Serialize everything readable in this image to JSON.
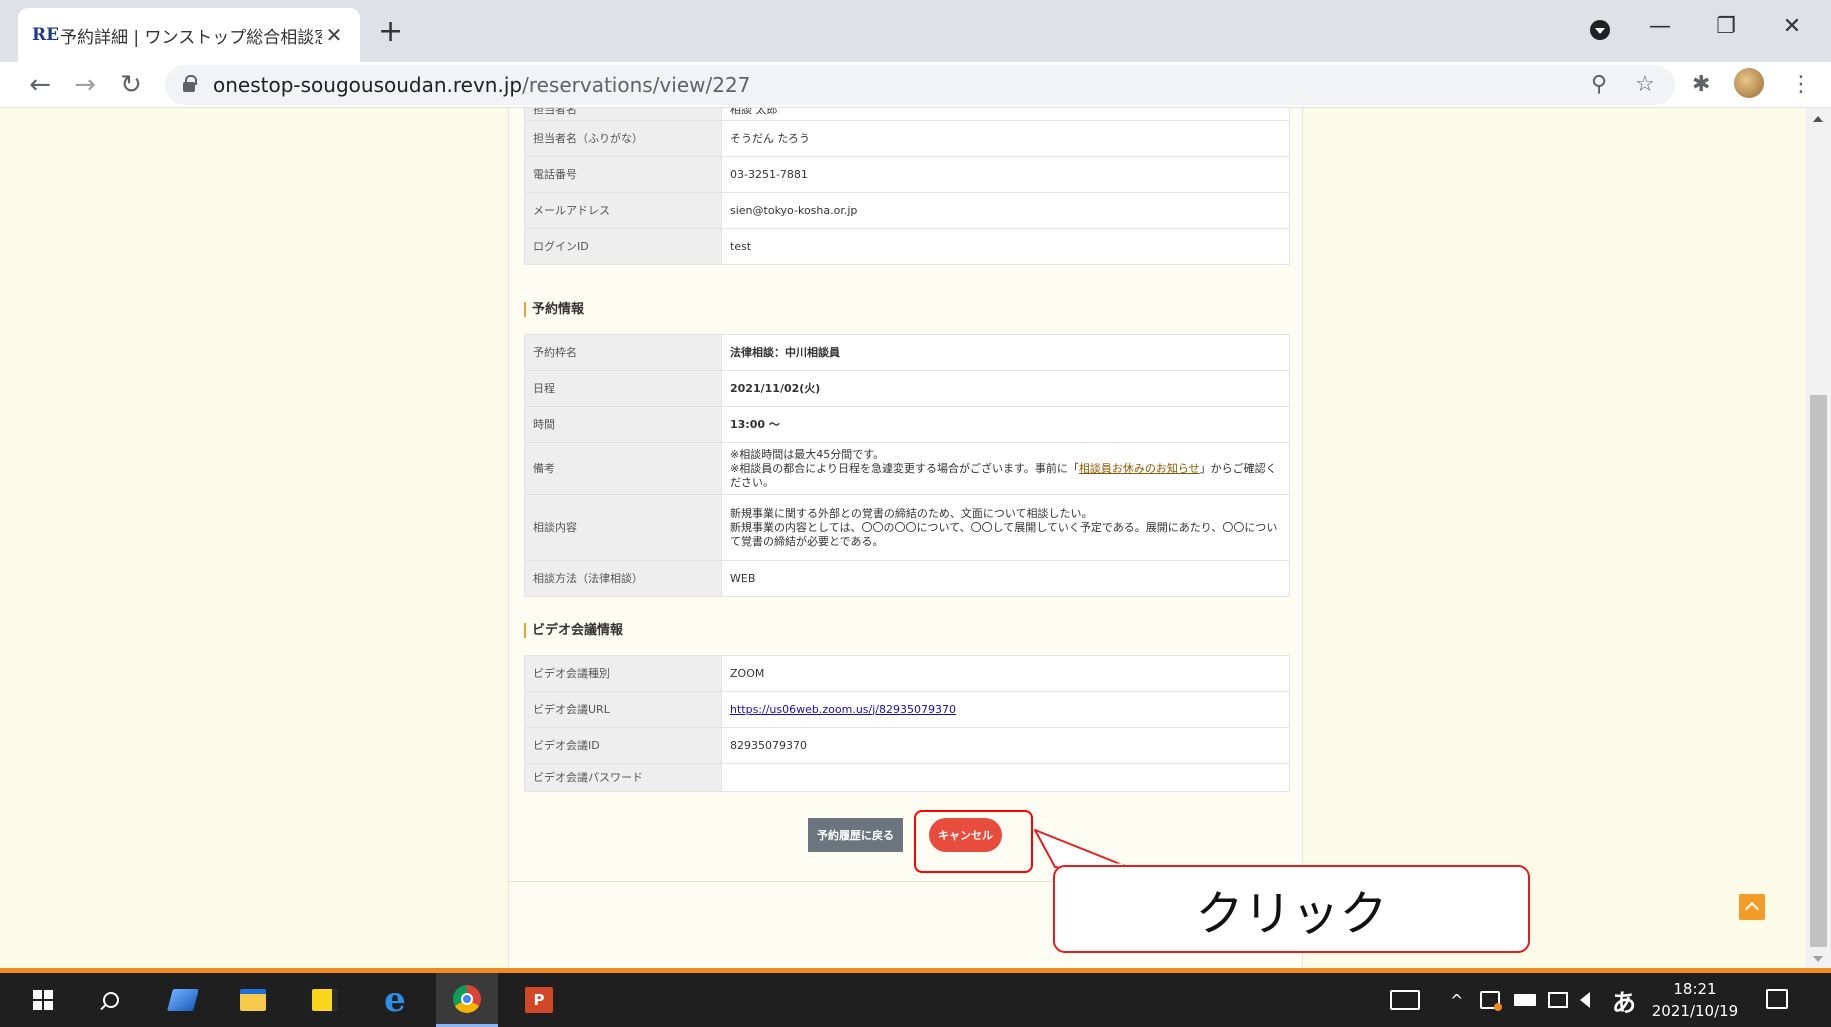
{
  "browser": {
    "tab_favicon": "RE",
    "tab_title": "予約詳細 | ワンストップ総合相談窓口",
    "tab_close": "✕",
    "new_tab": "+",
    "url_host": "onestop-sougousoudan.revn.jp",
    "url_path": "/reservations/view/227",
    "controls": {
      "minimize": "—",
      "restore": "❐",
      "close": "✕"
    },
    "nav": {
      "back": "←",
      "forward": "→",
      "reload": "↻"
    },
    "omni_icons": {
      "zoom": "⚲",
      "star": "☆",
      "extensions": "✱",
      "menu": "⋮"
    }
  },
  "staff_table": {
    "rows": [
      {
        "label": "担当者名",
        "value": "相談 太郎"
      },
      {
        "label": "担当者名（ふりがな）",
        "value": "そうだん たろう"
      },
      {
        "label": "電話番号",
        "value": "03-3251-7881"
      },
      {
        "label": "メールアドレス",
        "value": "sien@tokyo-kosha.or.jp"
      },
      {
        "label": "ログインID",
        "value": "test"
      }
    ]
  },
  "reservation": {
    "heading": "予約情報",
    "rows": [
      {
        "label": "予約枠名",
        "value": "法律相談：中川相談員"
      },
      {
        "label": "日程",
        "value": "2021/11/02(火)"
      },
      {
        "label": "時間",
        "value": "13:00 ～"
      },
      {
        "label": "備考",
        "line1": "※相談時間は最大45分間です。",
        "line2_before": "※相談員の都合により日程を急遽変更する場合がございます。事前に「",
        "line2_link": "相談員お休みのお知らせ",
        "line2_after": "」からご確認ください。"
      },
      {
        "label": "相談内容",
        "line1": "新規事業に関する外部との覚書の締結のため、文面について相談したい。",
        "line2": "新規事業の内容としては、〇〇の〇〇について、〇〇して展開していく予定である。展開にあたり、〇〇について覚書の締結が必要とである。"
      },
      {
        "label": "相談方法（法律相談）",
        "value": "WEB"
      }
    ]
  },
  "video": {
    "heading": "ビデオ会議情報",
    "rows": [
      {
        "label": "ビデオ会議種別",
        "value": "ZOOM"
      },
      {
        "label": "ビデオ会議URL",
        "value": "https://us06web.zoom.us/j/82935079370"
      },
      {
        "label": "ビデオ会議ID",
        "value": "82935079370"
      },
      {
        "label": "ビデオ会議パスワード",
        "value": ""
      }
    ]
  },
  "buttons": {
    "back_label": "予約履歴に戻る",
    "cancel_label": "キャンセル"
  },
  "annotation": {
    "callout_text": "クリック",
    "color": "#e21e1e"
  },
  "taskbar": {
    "ime": "あ",
    "time": "18:21",
    "date": "2021/10/19",
    "up_arrow": "^"
  },
  "colors": {
    "cancel_button": "#e74c3c",
    "back_button": "#6c757d",
    "page_background": "#fcfbe8",
    "accent": "#f08a24"
  }
}
